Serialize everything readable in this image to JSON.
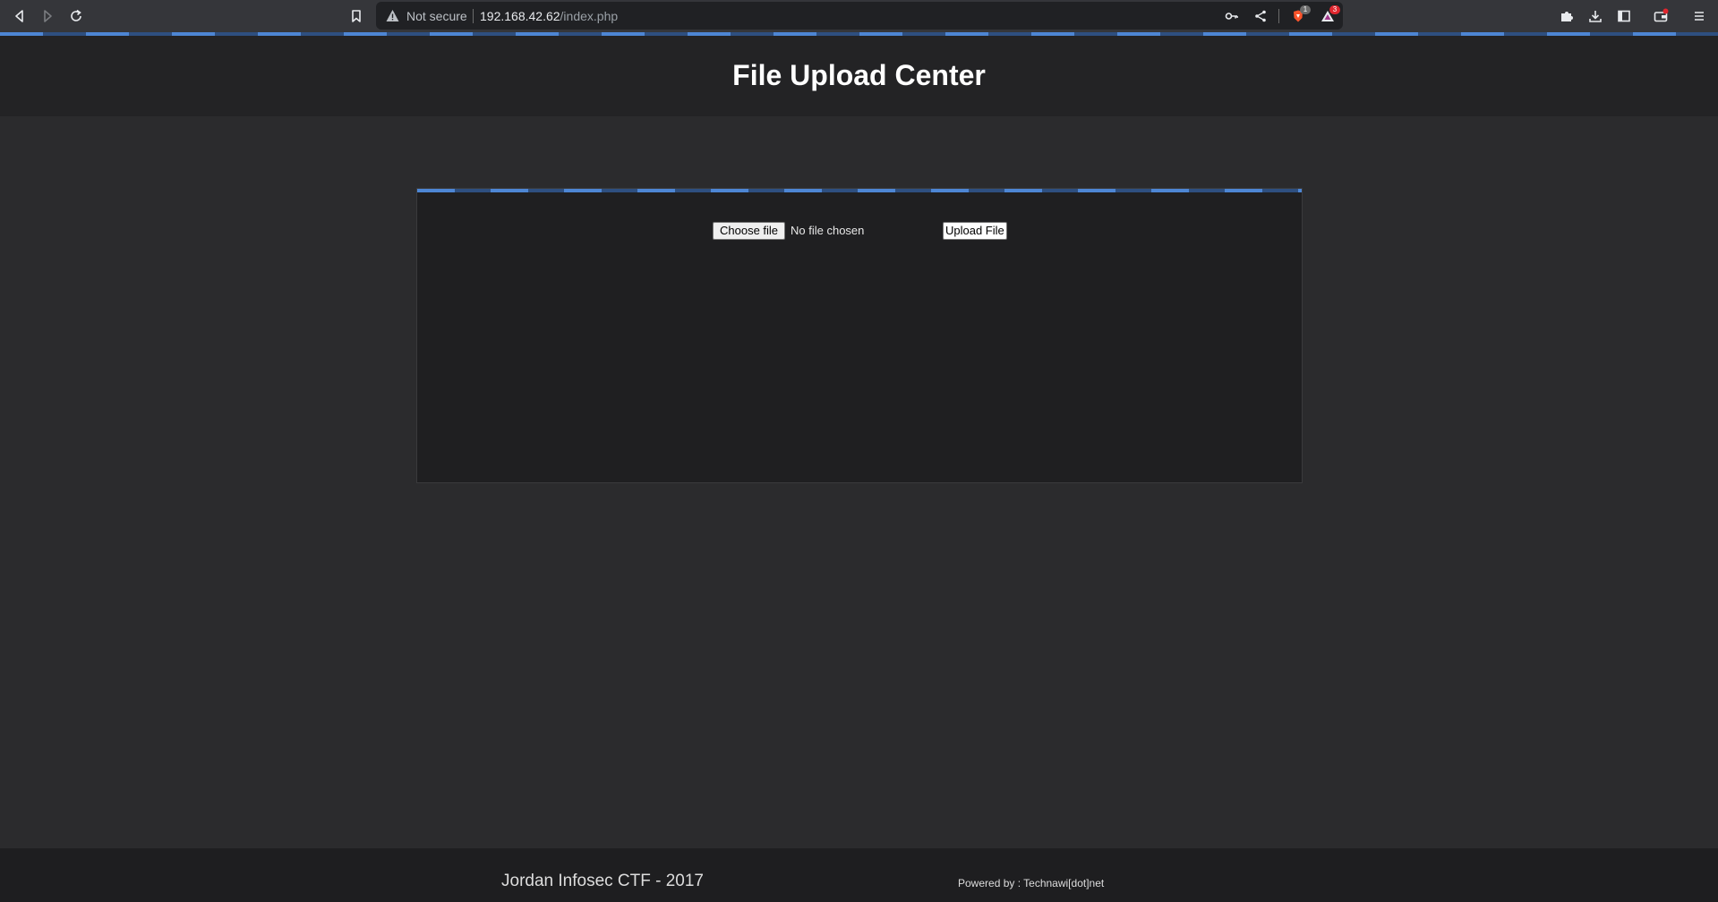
{
  "browser": {
    "security_label": "Not secure",
    "url_host": "192.168.42.62",
    "url_path": "/index.php",
    "brave_badge": "1",
    "rewards_badge": "3"
  },
  "page": {
    "title": "File Upload Center",
    "form": {
      "choose_file_label": "Choose file",
      "no_file_text": "No file chosen",
      "upload_label": "Upload File"
    },
    "footer": {
      "left_text": "Jordan Infosec CTF - 2017",
      "right_text": "Powered by : Technawi[dot]net"
    }
  },
  "colors": {
    "accent": "#4d86d4",
    "background": "#2b2b2d",
    "header": "#232325"
  }
}
